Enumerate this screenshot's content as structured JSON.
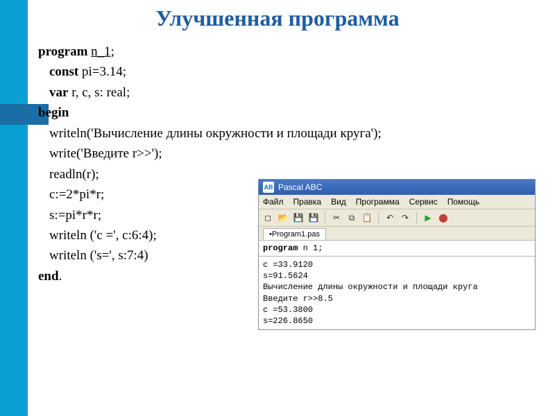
{
  "title": "Улучшенная программа",
  "code": {
    "l1a": "program",
    "l1b": "n_1",
    "l1c": ";",
    "l2a": "const",
    "l2b": " pi=3.14;",
    "l3a": "var",
    "l3b": " r, c, s: real;",
    "l4": "begin",
    "l5": "writeln('Вычисление длины окружности и площади круга');",
    "l6": "write('Введите r>>');",
    "l7": "readln(r);",
    "l8": "c:=2*pi*r;",
    "l9": "s:=pi*r*r;",
    "l10": "writeln ('c =', c:6:4);",
    "l11": "writeln ('s=', s:7:4)",
    "l12a": "end",
    "l12b": "."
  },
  "ide": {
    "title": "Pascal ABC",
    "menu": [
      "Файл",
      "Правка",
      "Вид",
      "Программа",
      "Сервис",
      "Помощь"
    ],
    "tab": "Program1.pas",
    "src_kw": "program",
    "src_rest": " n 1;",
    "out": [
      "c =33.9120",
      "s=91.5624",
      "Вычисление длины окружности и площади круга",
      "Введите r>>8.5",
      "c =53.3800",
      "s=226.8650"
    ]
  },
  "icons": {
    "new": "◻",
    "open": "📂",
    "save": "💾",
    "saveall": "💾",
    "cut": "✂",
    "copy": "⧉",
    "paste": "📋",
    "undo": "↶",
    "redo": "↷",
    "run": "▶",
    "stop": "⬤"
  }
}
